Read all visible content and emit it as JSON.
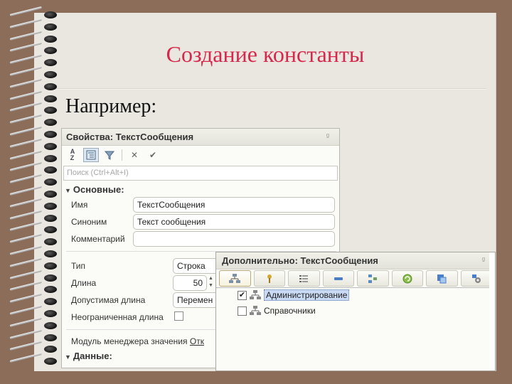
{
  "slide": {
    "title": "Создание константы",
    "example_label": "Например:"
  },
  "properties_panel": {
    "title": "Свойства: ТекстСообщения",
    "pin_glyph": "ᵍ",
    "search_placeholder": "Поиск (Ctrl+Alt+I)",
    "section_main": "Основные:",
    "fields": {
      "name_label": "Имя",
      "name_value": "ТекстСообщения",
      "synonym_label": "Синоним",
      "synonym_value": "Текст сообщения",
      "comment_label": "Комментарий",
      "comment_value": "",
      "type_label": "Тип",
      "type_value": "Строка",
      "length_label": "Длина",
      "length_value": "50",
      "allowed_length_label": "Допустимая длина",
      "allowed_length_value": "Перемен",
      "unlimited_length_label": "Неограниченная длина",
      "manager_module_label": "Модуль менеджера значения",
      "manager_module_link": "Отк"
    },
    "section_data": "Данные:"
  },
  "additional_window": {
    "title": "Дополнительно: ТекстСообщения",
    "pin_glyph": "ᵍ",
    "tabs": [
      "subsystems",
      "roles",
      "functional-options",
      "interfaces",
      "settings",
      "exchange",
      "command-interface",
      "storage"
    ],
    "tree": [
      {
        "label": "Администрирование",
        "checked": true,
        "selected": true
      },
      {
        "label": "Справочники",
        "checked": false,
        "selected": false
      }
    ]
  }
}
